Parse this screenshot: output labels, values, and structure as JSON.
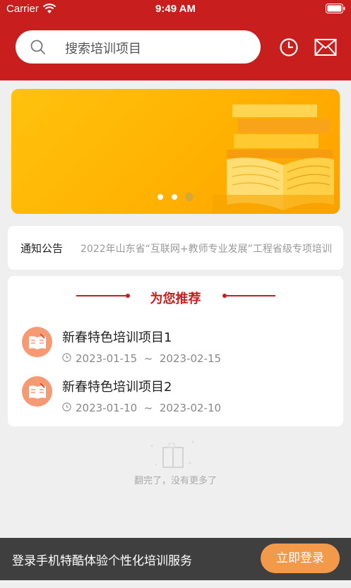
{
  "status_bar": {
    "carrier": "Carrier",
    "time": "9:49 AM"
  },
  "header": {
    "search_placeholder": "搜索培训项目",
    "icons": [
      "search-icon",
      "clock-icon",
      "mail-icon"
    ],
    "background_color": "#c81e1e"
  },
  "banner": {
    "slide_count": 3,
    "active_slide": 3
  },
  "notice": {
    "label": "通知公告",
    "text": "2022年山东省“互联网+教师专业发展”工程省级专项培训"
  },
  "recommend": {
    "title": "为您推荐",
    "items": [
      {
        "title": "新春特色培训项目1",
        "start": "2023-01-15",
        "separator": "~",
        "end": "2023-02-15"
      },
      {
        "title": "新春特色培训项目2",
        "start": "2023-01-10",
        "separator": "~",
        "end": "2023-02-10"
      }
    ]
  },
  "empty_tip": "翻完了，没有更多了",
  "bottom_bar": {
    "text": "登录手机特酷体验个性化培训服务",
    "button_label": "立即登录",
    "button_color": "#f2994a"
  }
}
